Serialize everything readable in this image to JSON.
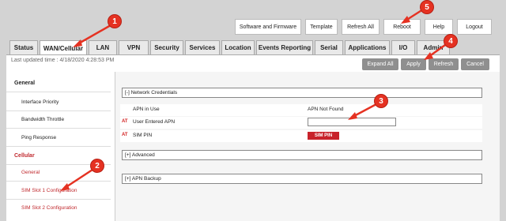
{
  "top_buttons": {
    "software": "Software and Firmware",
    "template": "Template",
    "refresh_all": "Refresh All",
    "reboot": "Reboot",
    "help": "Help",
    "logout": "Logout"
  },
  "tabs": [
    "Status",
    "WAN/Cellular",
    "LAN",
    "VPN",
    "Security",
    "Services",
    "Location",
    "Events Reporting",
    "Serial",
    "Applications",
    "I/O",
    "Admin"
  ],
  "active_tab": "WAN/Cellular",
  "status": {
    "updated_text": "Last updated time : 4/18/2020 4:28:53 PM"
  },
  "actions": {
    "expand_all": "Expand All",
    "apply": "Apply",
    "refresh": "Refresh",
    "cancel": "Cancel"
  },
  "sidebar": {
    "general_heading": "General",
    "general_items": [
      "Interface Priority",
      "Bandwidth Throttle",
      "Ping Response"
    ],
    "cellular_heading": "Cellular",
    "cellular_items": [
      "General",
      "SIM Slot 1 Configuration",
      "SIM Slot 2 Configuration"
    ]
  },
  "sections": {
    "network_credentials": "[-] Network Credentials",
    "advanced": "[+] Advanced",
    "apn_backup": "[+] APN Backup"
  },
  "fields": {
    "apn_in_use_label": "APN in Use",
    "apn_in_use_value": "APN Not Found",
    "user_apn_label": "User Entered APN",
    "user_apn_value": "",
    "sim_pin_label": "SIM PIN",
    "sim_pin_button": "SIM PIN",
    "at_marker": "AT"
  },
  "callouts": [
    "1",
    "2",
    "3",
    "4",
    "5"
  ],
  "colors": {
    "callout": "#e53222",
    "sidebar_active": "#c0282d",
    "action_button": "#8f8f8f"
  }
}
